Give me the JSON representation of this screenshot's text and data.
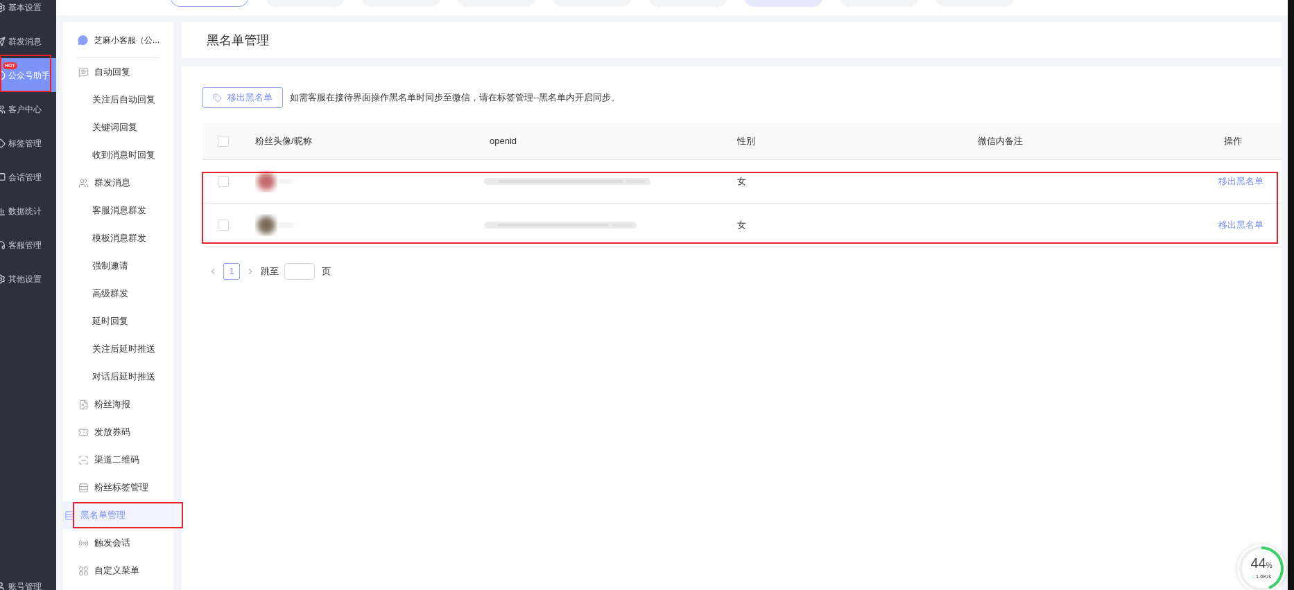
{
  "nav": [
    {
      "label": "基本设置",
      "selected": false
    },
    {
      "label": "群发消息",
      "selected": false
    },
    {
      "label": "公众号助手",
      "selected": true,
      "badge": "HOT"
    },
    {
      "label": "客户中心",
      "selected": false
    },
    {
      "label": "标签管理",
      "selected": false
    },
    {
      "label": "会话管理",
      "selected": false
    },
    {
      "label": "数据统计",
      "selected": false
    },
    {
      "label": "客服管理",
      "selected": false
    },
    {
      "label": "其他设置",
      "selected": false
    }
  ],
  "nav_footer": {
    "label": "账号管理"
  },
  "top_tabs": [
    {
      "kind": "outlined"
    },
    {
      "kind": "plain"
    },
    {
      "kind": "plain"
    },
    {
      "kind": "plain"
    },
    {
      "kind": "plain"
    },
    {
      "kind": "plain"
    },
    {
      "kind": "tinted"
    },
    {
      "kind": "plain"
    },
    {
      "kind": "plain"
    }
  ],
  "account": {
    "name": "芝麻小客服（公..."
  },
  "menu": [
    {
      "label": "自动回复",
      "selected": false,
      "children": [
        {
          "label": "关注后自动回复",
          "selected": false
        },
        {
          "label": "关键词回复",
          "selected": false
        },
        {
          "label": "收到消息时回复",
          "selected": false
        }
      ]
    },
    {
      "label": "群发消息",
      "selected": false,
      "children": [
        {
          "label": "客服消息群发",
          "selected": false
        },
        {
          "label": "模板消息群发",
          "selected": false
        },
        {
          "label": "强制邀请",
          "selected": false
        },
        {
          "label": "高级群发",
          "selected": false
        },
        {
          "label": "延时回复",
          "selected": false
        },
        {
          "label": "关注后延时推送",
          "selected": false
        },
        {
          "label": "对话后延时推送",
          "selected": false
        }
      ]
    },
    {
      "label": "粉丝海报",
      "selected": false
    },
    {
      "label": "发放券码",
      "selected": false
    },
    {
      "label": "渠道二维码",
      "selected": false
    },
    {
      "label": "粉丝标签管理",
      "selected": false
    },
    {
      "label": "黑名单管理",
      "selected": true
    },
    {
      "label": "触发会话",
      "selected": false
    },
    {
      "label": "自定义菜单",
      "selected": false
    }
  ],
  "page_title": "黑名单管理",
  "toolbar": {
    "button": "移出黑名单",
    "note": "如需客服在接待界面操作黑名单时同步至微信，请在标签管理--黑名单内开启同步。"
  },
  "table": {
    "header_checked": false,
    "columns": [
      "粉丝头像/昵称",
      "openid",
      "性别",
      "微信内备注",
      "操作"
    ],
    "rows": [
      {
        "checked": false,
        "gender": "女",
        "action": "移出黑名单"
      },
      {
        "checked": false,
        "gender": "女",
        "action": "移出黑名单"
      }
    ]
  },
  "pagination": {
    "pages": [
      {
        "label": "1",
        "selected": true
      }
    ],
    "jump_label": "跳至",
    "page_suffix": "页"
  },
  "speed_widget": {
    "level": 0.44,
    "percent": "44",
    "unit": "%",
    "arrow": "↓",
    "speed": "1.6K/s"
  }
}
